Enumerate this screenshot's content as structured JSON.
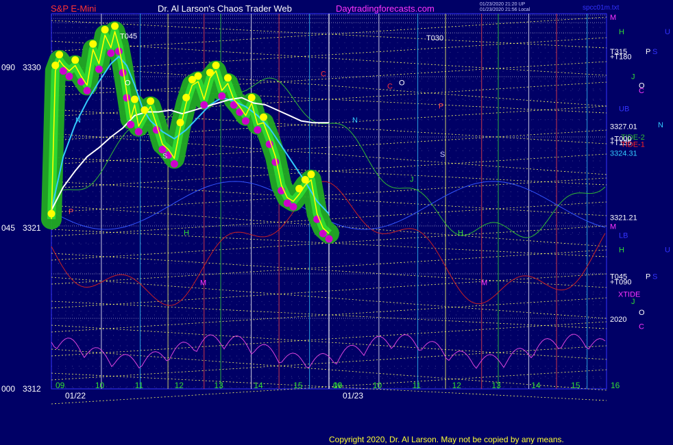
{
  "header": {
    "symbol": "S&P E-Mini",
    "author": "Dr. Al Larson's Chaos Trader Web",
    "site": "Daytradingforecasts.com",
    "stamp_line1": "01/23/2020 21:20 UP",
    "stamp_line2": "01/23/2020 21:56 Local",
    "file": "spcc01m.txt"
  },
  "footer": {
    "copyright": "Copyright 2020, Dr. Al Larson. May not be copied by any means."
  },
  "colors": {
    "background": "#000066",
    "grid_dots": "#c8c8ff",
    "yellow_lines": "#ffff66",
    "price_line": "#ffff00",
    "glow": "#22aa22",
    "dots_yellow": "#ffff00",
    "dots_magenta": "#cc00cc",
    "avg_cyan": "#33ccff",
    "avg_white": "#ffffff",
    "tide1": "#cc2222",
    "tide2": "#33bb33",
    "xtide": "#dd44dd"
  },
  "chart_data": {
    "type": "line",
    "title": "S&P E-Mini",
    "ylim": [
      3312,
      3333
    ],
    "y_ticks_left": [
      {
        "label": "090",
        "value": "3330"
      },
      {
        "label": "045",
        "value": "3321"
      },
      {
        "label": "000",
        "value": "3312"
      }
    ],
    "hour_ticks_day1": [
      "09",
      "10",
      "11",
      "12",
      "13",
      "14",
      "15",
      "16"
    ],
    "hour_ticks_day2": [
      "09",
      "10",
      "11",
      "12",
      "13",
      "14",
      "15",
      "16"
    ],
    "dates": [
      "01/22",
      "01/23"
    ],
    "series": [
      {
        "name": "",
        "x": [
          9.0,
          9.1,
          9.2,
          9.3,
          9.45,
          9.6,
          9.75,
          9.9,
          10.05,
          10.2,
          10.35,
          10.5,
          10.6,
          10.7,
          10.8,
          10.9,
          11.0,
          11.1,
          11.2,
          11.35,
          11.5,
          11.65,
          11.8,
          11.95,
          12.1,
          12.25,
          12.4,
          12.55,
          12.7,
          12.85,
          13.0,
          13.15,
          13.3,
          13.45,
          13.6,
          13.75,
          13.9,
          14.05,
          14.2,
          14.35,
          14.5,
          14.65,
          14.8,
          14.95,
          15.1,
          15.25,
          15.4,
          15.55,
          15.7,
          15.85,
          16.0
        ],
        "values": [
          3321.5,
          3329.8,
          3330.4,
          3330.1,
          3329.8,
          3330.1,
          3329.5,
          3329.0,
          3331.0,
          3330.2,
          3331.8,
          3331.1,
          3332.0,
          3331.2,
          3330.0,
          3328.6,
          3327.1,
          3327.9,
          3326.7,
          3327.3,
          3327.8,
          3326.8,
          3325.7,
          3325.4,
          3324.9,
          3326.6,
          3328.0,
          3329.0,
          3329.2,
          3328.2,
          3329.4,
          3329.8,
          3328.7,
          3329.1,
          3328.2,
          3327.8,
          3327.3,
          3328.0,
          3326.8,
          3326.9,
          3326.0,
          3325.0,
          3323.4,
          3322.7,
          3322.5,
          3322.9,
          3323.4,
          3323.7,
          3321.8,
          3321.0,
          3320.7
        ]
      },
      {
        "name": "",
        "x": [
          9.0,
          9.3,
          9.6,
          9.9,
          10.2,
          10.5,
          10.7,
          10.9,
          11.1,
          11.3,
          11.5,
          11.8,
          12.1,
          12.4,
          12.7,
          13.0,
          13.3,
          13.6,
          13.9,
          14.2,
          14.5,
          14.8,
          15.1,
          15.4,
          15.7,
          16.0
        ],
        "values": [
          3322.0,
          3325.0,
          3326.8,
          3328.1,
          3329.2,
          3330.2,
          3330.6,
          3330.1,
          3329.0,
          3327.7,
          3327.0,
          3326.4,
          3326.0,
          3326.5,
          3327.2,
          3327.9,
          3328.3,
          3328.1,
          3327.8,
          3327.3,
          3326.6,
          3325.6,
          3324.6,
          3323.6,
          3322.5,
          3321.8
        ]
      },
      {
        "name": "",
        "x": [
          9.0,
          9.3,
          9.6,
          9.9,
          10.2,
          10.5,
          10.8,
          11.1,
          11.4,
          11.7,
          12.0,
          12.3,
          12.6,
          12.9,
          13.2,
          13.5,
          13.8,
          14.1,
          14.4,
          14.7,
          15.0,
          15.3,
          15.6,
          16.0
        ],
        "values": [
          3322.0,
          3323.3,
          3324.2,
          3325.0,
          3325.5,
          3326.1,
          3326.6,
          3327.3,
          3327.5,
          3327.5,
          3327.6,
          3327.4,
          3327.6,
          3327.8,
          3328.0,
          3328.2,
          3328.3,
          3328.0,
          3327.9,
          3327.6,
          3327.3,
          3327.0,
          3326.9,
          3326.9
        ]
      }
    ],
    "left_markers": [
      {
        "label": "N",
        "value": 3326.9
      },
      {
        "label": "O",
        "value": 3329.0
      },
      {
        "label": "S",
        "value": 3324.9
      },
      {
        "label": "P",
        "value": 3321.8
      },
      {
        "label": "H",
        "value": 3320.6
      },
      {
        "label": "M",
        "value": 3317.8
      },
      {
        "label": "T045",
        "value": 3331.6
      },
      {
        "label": "C",
        "value": 3329.5
      }
    ],
    "right_markers": [
      {
        "label": "T030",
        "value": 3331.5
      },
      {
        "label": "O",
        "value": 3329.0
      },
      {
        "label": "P",
        "value": 3327.7
      },
      {
        "label": "N",
        "value": 3326.9
      },
      {
        "label": "S",
        "value": 3325.0
      },
      {
        "label": "J",
        "value": 3323.6
      },
      {
        "label": "H",
        "value": 3320.6
      },
      {
        "label": "M",
        "value": 3317.8
      },
      {
        "label": "C",
        "value": 3328.8
      }
    ],
    "right_axis": [
      {
        "label": "M",
        "color": "#ff33ff",
        "value": 3332.8
      },
      {
        "label": "H",
        "color": "#33dd33",
        "value": 3332.0
      },
      {
        "label": "U",
        "color": "#3333ff",
        "value": 3332.0
      },
      {
        "label": "T315",
        "color": "#ffffff",
        "value": 3330.9
      },
      {
        "label": "+T180",
        "color": "#ffffff",
        "value": 3330.6
      },
      {
        "label": "P",
        "color": "#ffffff",
        "value": 3330.9
      },
      {
        "label": "S",
        "color": "#3333ff",
        "value": 3330.9
      },
      {
        "label": "J",
        "color": "#33dd33",
        "value": 3329.5
      },
      {
        "label": "O",
        "color": "#ffffff",
        "value": 3329.0
      },
      {
        "label": "C",
        "color": "#ff33ff",
        "value": 3328.7
      },
      {
        "label": "UB",
        "color": "#3333ff",
        "value": 3327.7
      },
      {
        "label": "N",
        "color": "#33ccff",
        "value": 3326.8
      },
      {
        "label": "3327.01",
        "color": "#ffffff",
        "value": 3326.7
      },
      {
        "label": "TIDE-2",
        "color": "#33bb33",
        "value": 3326.1
      },
      {
        "label": "+T000",
        "color": "#ffffff",
        "value": 3326.0
      },
      {
        "label": "+T135",
        "color": "#ffffff",
        "value": 3325.8
      },
      {
        "label": "TIDE-1",
        "color": "#ff2222",
        "value": 3325.7
      },
      {
        "label": "3324.31",
        "color": "#33ccff",
        "value": 3325.2
      },
      {
        "label": "3321.21",
        "color": "#ffffff",
        "value": 3321.6
      },
      {
        "label": "M",
        "color": "#ff33ff",
        "value": 3321.1
      },
      {
        "label": "LB",
        "color": "#3333ff",
        "value": 3320.6
      },
      {
        "label": "H",
        "color": "#33dd33",
        "value": 3319.8
      },
      {
        "label": "U",
        "color": "#3333ff",
        "value": 3319.8
      },
      {
        "label": "T045",
        "color": "#ffffff",
        "value": 3318.3
      },
      {
        "label": "+T090",
        "color": "#ffffff",
        "value": 3318.0
      },
      {
        "label": "P",
        "color": "#ffffff",
        "value": 3318.3
      },
      {
        "label": "S",
        "color": "#3333ff",
        "value": 3318.3
      },
      {
        "label": "XTIDE",
        "color": "#ff33ff",
        "value": 3317.3
      },
      {
        "label": "J",
        "color": "#33dd33",
        "value": 3316.9
      },
      {
        "label": "O",
        "color": "#ffffff",
        "value": 3316.3
      },
      {
        "label": "2020",
        "color": "#ffffff",
        "value": 3315.9
      },
      {
        "label": "C",
        "color": "#ff33ff",
        "value": 3315.5
      }
    ]
  }
}
